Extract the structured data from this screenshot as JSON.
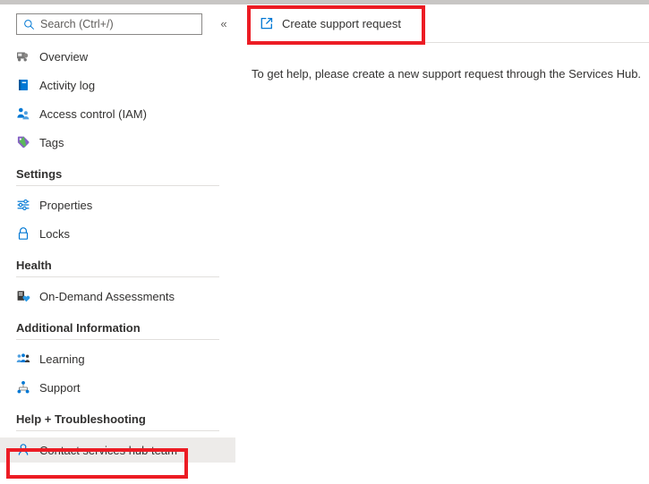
{
  "search": {
    "placeholder": "Search (Ctrl+/)",
    "value": "",
    "collapse_glyph": "«"
  },
  "sidebar": {
    "items": [
      {
        "label": "Overview",
        "icon": "overview-icon"
      },
      {
        "label": "Activity log",
        "icon": "activity-log-icon"
      },
      {
        "label": "Access control (IAM)",
        "icon": "access-control-icon"
      },
      {
        "label": "Tags",
        "icon": "tags-icon"
      }
    ],
    "sections": [
      {
        "title": "Settings",
        "items": [
          {
            "label": "Properties",
            "icon": "properties-icon"
          },
          {
            "label": "Locks",
            "icon": "lock-icon"
          }
        ]
      },
      {
        "title": "Health",
        "items": [
          {
            "label": "On-Demand Assessments",
            "icon": "assessments-icon"
          }
        ]
      },
      {
        "title": "Additional Information",
        "items": [
          {
            "label": "Learning",
            "icon": "learning-icon"
          },
          {
            "label": "Support",
            "icon": "support-icon"
          }
        ]
      },
      {
        "title": "Help + Troubleshooting",
        "items": [
          {
            "label": "Contact services hub team",
            "icon": "contact-person-icon",
            "selected": true
          }
        ]
      }
    ]
  },
  "main": {
    "toolbar": {
      "create_support_request_label": "Create support request",
      "create_support_request_icon": "external-link-icon"
    },
    "body_text": "To get help, please create a new support request through the Services Hub."
  },
  "colors": {
    "accent": "#0078d4",
    "annotation": "#ec1c24",
    "selected_background": "#edebe9",
    "text": "#323130",
    "rule": "#e1dfdd"
  }
}
